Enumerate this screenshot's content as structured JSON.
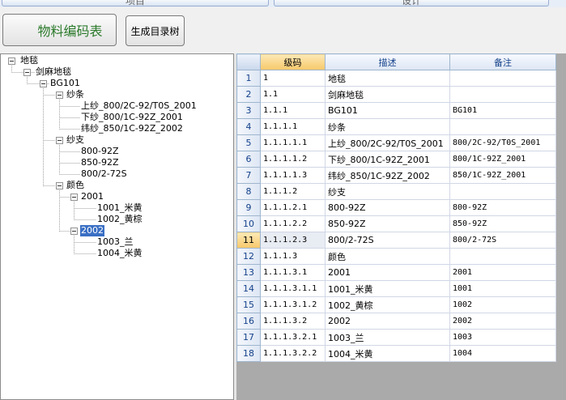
{
  "top_tabs": [
    {
      "label": "项目"
    },
    {
      "label": "设计"
    }
  ],
  "toolbar": {
    "main_label": "物料编码表",
    "tree_button_label": "生成目录树"
  },
  "tree": {
    "nodes": [
      {
        "label": "地毯"
      },
      {
        "label": "剑麻地毯"
      },
      {
        "label": "BG101"
      },
      {
        "label": "纱条"
      },
      {
        "label": "上纱_800/2C-92/T0S_2001"
      },
      {
        "label": "下纱_800/1C-92Z_2001"
      },
      {
        "label": "纬纱_850/1C-92Z_2002"
      },
      {
        "label": "纱支"
      },
      {
        "label": "800-92Z"
      },
      {
        "label": "850-92Z"
      },
      {
        "label": "800/2-72S"
      },
      {
        "label": "颜色"
      },
      {
        "label": "2001"
      },
      {
        "label": "1001_米黄"
      },
      {
        "label": "1002_黄棕"
      },
      {
        "label": "2002"
      },
      {
        "label": "1003_兰"
      },
      {
        "label": "1004_米黄"
      }
    ],
    "selected": "2002"
  },
  "grid": {
    "columns": [
      "级码",
      "描述",
      "备注"
    ],
    "sorted_column": "级码",
    "active_row": 11,
    "rows": [
      {
        "num": "1",
        "code": "1",
        "desc": "地毯",
        "note": ""
      },
      {
        "num": "2",
        "code": "1.1",
        "desc": "剑麻地毯",
        "note": ""
      },
      {
        "num": "3",
        "code": "1.1.1",
        "desc": "BG101",
        "note": "BG101"
      },
      {
        "num": "4",
        "code": "1.1.1.1",
        "desc": "纱条",
        "note": ""
      },
      {
        "num": "5",
        "code": "1.1.1.1.1",
        "desc": "上纱_800/2C-92/T0S_2001",
        "note": "800/2C-92/T0S_2001"
      },
      {
        "num": "6",
        "code": "1.1.1.1.2",
        "desc": "下纱_800/1C-92Z_2001",
        "note": "800/1C-92Z_2001"
      },
      {
        "num": "7",
        "code": "1.1.1.1.3",
        "desc": "纬纱_850/1C-92Z_2002",
        "note": "850/1C-92Z_2001"
      },
      {
        "num": "8",
        "code": "1.1.1.2",
        "desc": "纱支",
        "note": ""
      },
      {
        "num": "9",
        "code": "1.1.1.2.1",
        "desc": "800-92Z",
        "note": "800-92Z"
      },
      {
        "num": "10",
        "code": "1.1.1.2.2",
        "desc": "850-92Z",
        "note": "850-92Z"
      },
      {
        "num": "11",
        "code": "1.1.1.2.3",
        "desc": "800/2-72S",
        "note": "800/2-72S"
      },
      {
        "num": "12",
        "code": "1.1.1.3",
        "desc": "颜色",
        "note": ""
      },
      {
        "num": "13",
        "code": "1.1.1.3.1",
        "desc": "2001",
        "note": "2001"
      },
      {
        "num": "14",
        "code": "1.1.1.3.1.1",
        "desc": "1001_米黄",
        "note": "1001"
      },
      {
        "num": "15",
        "code": "1.1.1.3.1.2",
        "desc": "1002_黄棕",
        "note": "1002"
      },
      {
        "num": "16",
        "code": "1.1.1.3.2",
        "desc": "2002",
        "note": "2002"
      },
      {
        "num": "17",
        "code": "1.1.1.3.2.1",
        "desc": "1003_兰",
        "note": "1003"
      },
      {
        "num": "18",
        "code": "1.1.1.3.2.2",
        "desc": "1004_米黄",
        "note": "1004"
      }
    ]
  }
}
